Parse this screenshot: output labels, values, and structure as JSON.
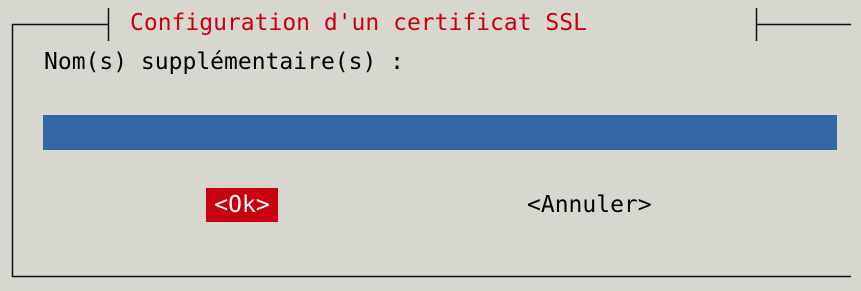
{
  "dialog": {
    "title": "Configuration d'un certificat SSL",
    "prompt": "Nom(s) supplémentaire(s) :",
    "input_value": "",
    "ok_label": "<Ok>",
    "cancel_label": "<Annuler>"
  },
  "colors": {
    "background": "#d7d7cf",
    "title": "#c8000f",
    "input_field": "#3465a4",
    "focused_button": "#c8000f"
  }
}
